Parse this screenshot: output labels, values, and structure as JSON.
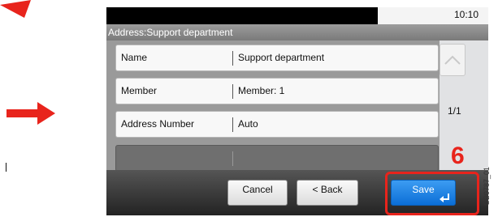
{
  "status": {
    "time": "10:10"
  },
  "title": "Address:Support department",
  "rows": [
    {
      "label": "Name",
      "value": "Support department"
    },
    {
      "label": "Member",
      "value": "Member: 1"
    },
    {
      "label": "Address Number",
      "value": "Auto"
    }
  ],
  "pagination": {
    "page": "1/1"
  },
  "buttons": {
    "cancel": "Cancel",
    "back": "< Back",
    "save": "Save"
  },
  "annotation": {
    "step": "6",
    "figure_id": "GB0787_01"
  },
  "colors": {
    "accent_red": "#e8241c",
    "save_blue": "#1a7fe2",
    "title_gray": "#8a8a8a"
  }
}
